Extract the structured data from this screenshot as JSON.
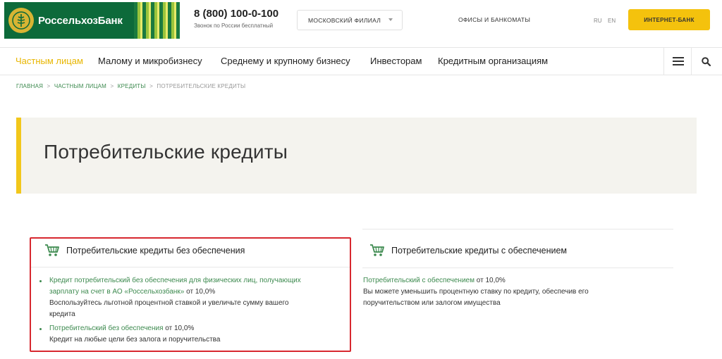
{
  "header": {
    "logo_text": "РоссельхозБанк",
    "phone": "8 (800) 100-0-100",
    "phone_note": "Звонок по России бесплатный",
    "branch": "МОСКОВСКИЙ ФИЛИАЛ",
    "offices": "ОФИСЫ И БАНКОМАТЫ",
    "lang_ru": "RU",
    "lang_en": "EN",
    "internet_bank": "ИНТЕРНЕТ-БАНК"
  },
  "nav": {
    "items": [
      {
        "label": "Частным лицам",
        "active": true
      },
      {
        "label": "Малому и микробизнесу"
      },
      {
        "label": "Среднему и крупному бизнесу"
      },
      {
        "label": "Инвесторам"
      },
      {
        "label": "Кредитным организациям"
      }
    ],
    "menu_icon": "hamburger-icon",
    "search_icon": "search-icon"
  },
  "breadcrumb": {
    "items": [
      "ГЛАВНАЯ",
      "ЧАСТНЫМ ЛИЦАМ",
      "КРЕДИТЫ"
    ],
    "separator": ">",
    "current": "ПОТРЕБИТЕЛЬСКИЕ КРЕДИТЫ"
  },
  "page_title": "Потребительские кредиты",
  "cards": {
    "unsecured": {
      "title": "Потребительские кредиты без обеспечения",
      "items": [
        {
          "link_line1": "Кредит потребительский без обеспечения для физических лиц, получающих",
          "link_line2": "зарплату на счет в АО «Россельхозбанк»",
          "rate": "от 10,0%",
          "desc_line1": "Воспользуйтесь льготной процентной ставкой и увеличьте сумму вашего",
          "desc_line2": "кредита"
        },
        {
          "link": "Потребительский без обеспечения",
          "rate": "от 10,0%",
          "desc": "Кредит на любые цели без залога и поручительства"
        }
      ]
    },
    "secured": {
      "title": "Потребительские кредиты с обеспечением",
      "item": {
        "link": "Потребительский с обеспечением",
        "rate": "от 10,0%",
        "desc_line1": "Вы можете уменьшить процентную ставку по кредиту, обеспечив его",
        "desc_line2": "поручительством или залогом имущества"
      }
    }
  },
  "colors": {
    "brand_green": "#0d6a3a",
    "link_green": "#3d8a4f",
    "accent_yellow": "#f4c20d",
    "highlight_red": "#d7282f"
  }
}
